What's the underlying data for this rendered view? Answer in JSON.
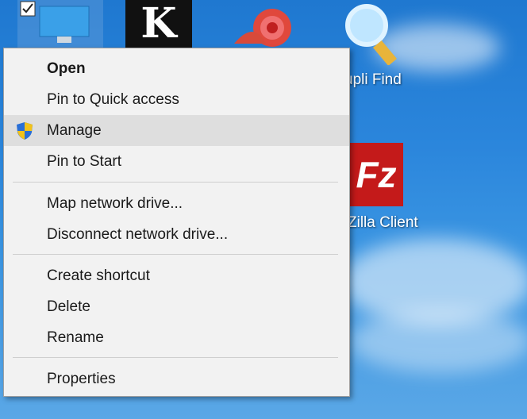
{
  "desktop": {
    "icons": [
      {
        "name": "this-pc-icon"
      },
      {
        "name": "k-app-icon"
      },
      {
        "name": "snail-app-icon"
      },
      {
        "name": "dupli-find-icon",
        "label": "upli Find"
      },
      {
        "name": "filezilla-icon",
        "label": "Zilla Client"
      }
    ]
  },
  "context_menu": {
    "items": [
      {
        "label": "Open",
        "bold": true
      },
      {
        "label": "Pin to Quick access"
      },
      {
        "label": "Manage",
        "icon": "shield-icon",
        "highlighted": true
      },
      {
        "label": "Pin to Start"
      },
      {
        "label": "Map network drive..."
      },
      {
        "label": "Disconnect network drive..."
      },
      {
        "label": "Create shortcut"
      },
      {
        "label": "Delete"
      },
      {
        "label": "Rename"
      },
      {
        "label": "Properties"
      }
    ]
  }
}
